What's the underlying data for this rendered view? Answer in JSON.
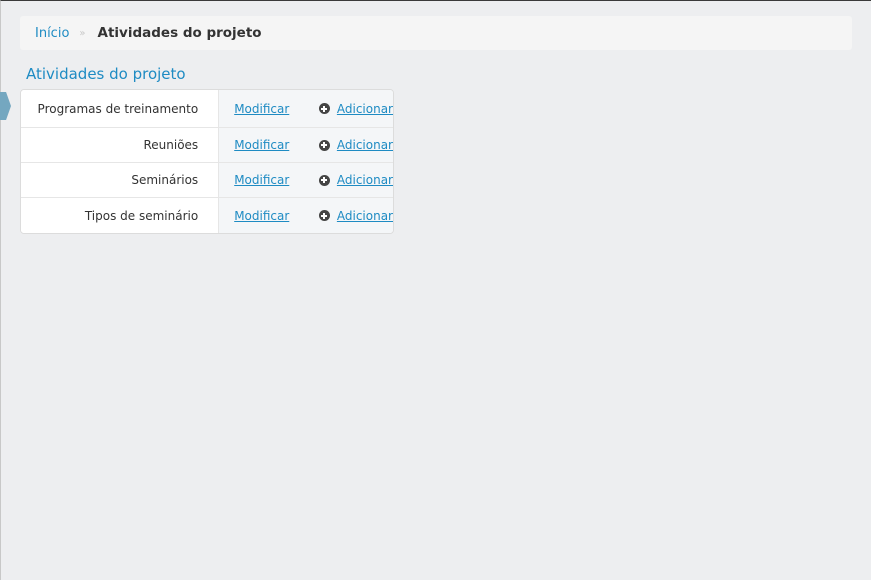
{
  "breadcrumb": {
    "home": "Início",
    "separator": "»",
    "current": "Atividades do projeto"
  },
  "module": {
    "title": "Atividades do projeto",
    "rows": [
      {
        "name": "Programas de treinamento",
        "change": "Modificar",
        "add": "Adicionar"
      },
      {
        "name": "Reuniões",
        "change": "Modificar",
        "add": "Adicionar"
      },
      {
        "name": "Seminários",
        "change": "Modificar",
        "add": "Adicionar"
      },
      {
        "name": "Tipos de seminário",
        "change": "Modificar",
        "add": "Adicionar"
      }
    ]
  },
  "icons": {
    "add": "plus-circle-icon",
    "sidebar_toggle": "sidebar-toggle-arrow-icon"
  },
  "colors": {
    "link": "#1e8bc3",
    "background": "#edeef0"
  }
}
